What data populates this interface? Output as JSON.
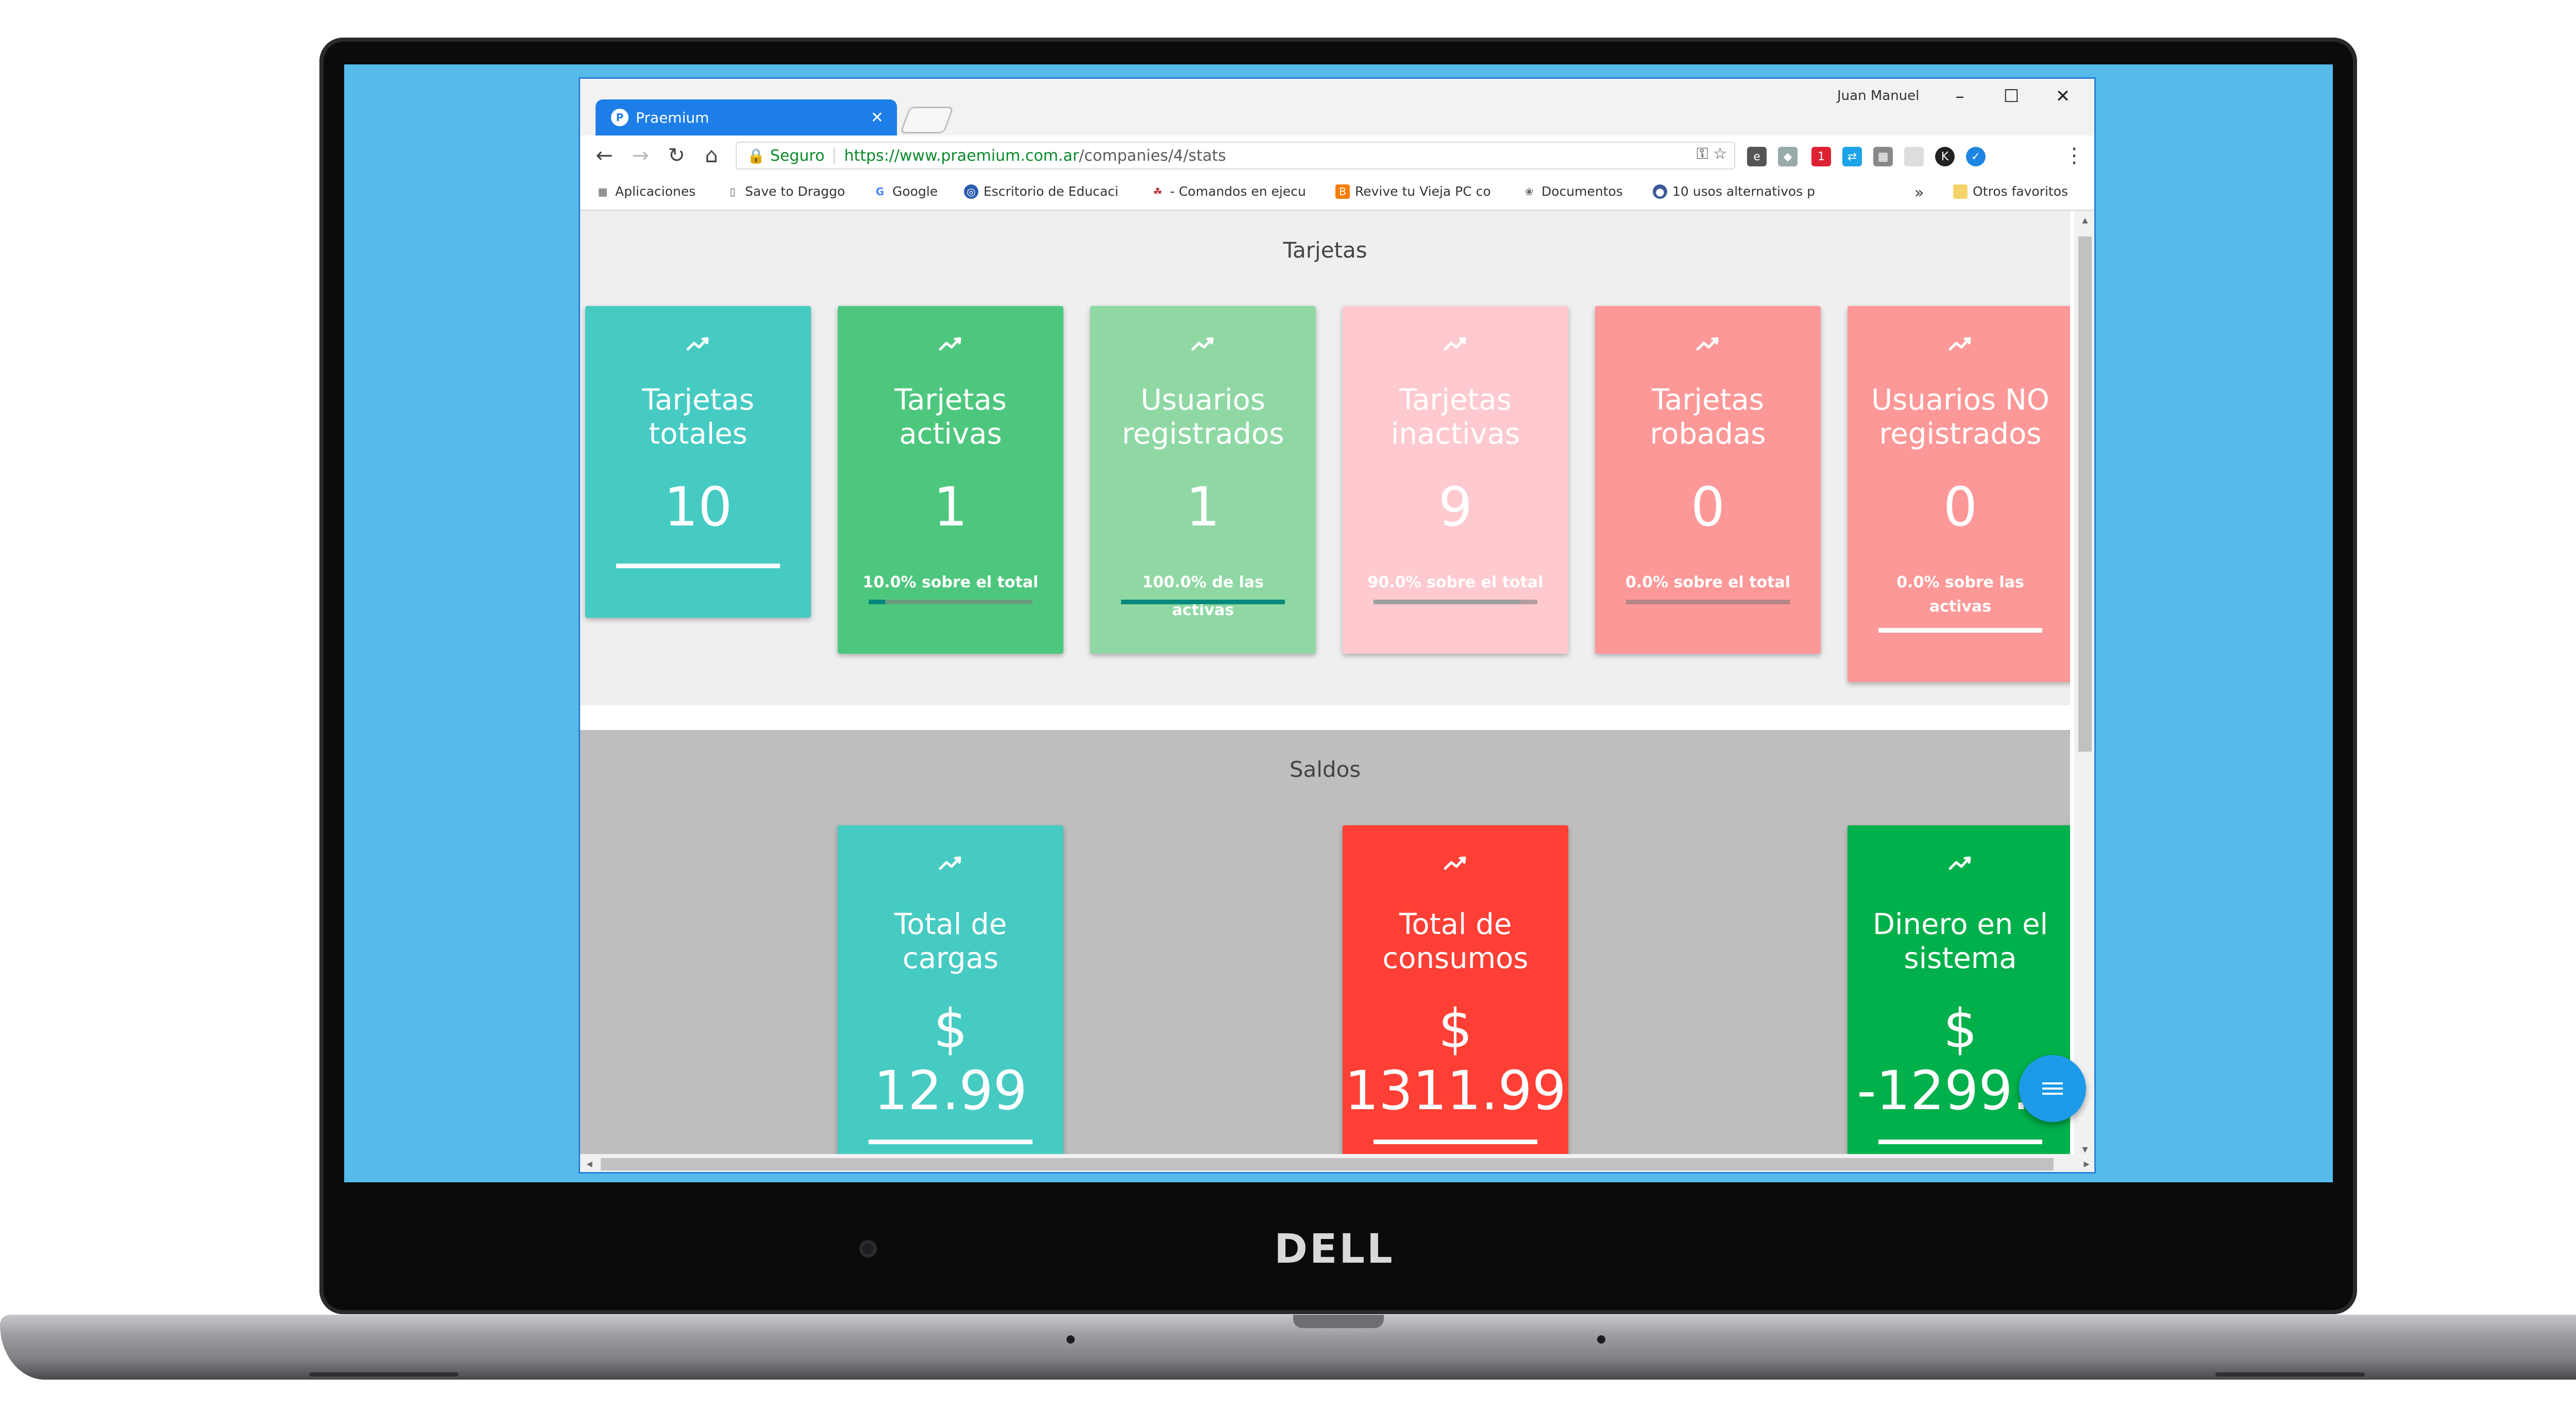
{
  "browser": {
    "tab_title": "Praemium",
    "tab_favicon": "P",
    "user_name": "Juan Manuel",
    "minimize": "–",
    "maximize": "☐",
    "close": "✕",
    "security_label": "Seguro",
    "url_base": "https://www.praemium.com.ar",
    "url_path": "/companies/4/stats"
  },
  "bookmarks": {
    "items": [
      "Aplicaciones",
      "Save to Draggo",
      "Google",
      "Escritorio de Educaci",
      "- Comandos en ejecu",
      "Revive tu Vieja PC co",
      "Documentos",
      "10 usos alternativos p"
    ],
    "overflow": "»",
    "other": "Otros favoritos"
  },
  "tarjetas": {
    "title": "Tarjetas",
    "cards": [
      {
        "label_1": "Tarjetas",
        "label_2": "totales",
        "value": "10",
        "sub": "",
        "color": "#46cbc3",
        "bar": 1.0,
        "bar_color": "#ffffff"
      },
      {
        "label_1": "Tarjetas",
        "label_2": "activas",
        "value": "1",
        "sub": "10.0% sobre el total",
        "color": "#4ec77e",
        "bar": 0.1,
        "bar_color": "#00897b"
      },
      {
        "label_1": "Usuarios",
        "label_2": "registrados",
        "value": "1",
        "sub": "100.0% de las activas",
        "color": "#8fd8a4",
        "bar": 1.0,
        "bar_color": "#00897b"
      },
      {
        "label_1": "Tarjetas",
        "label_2": "inactivas",
        "value": "9",
        "sub": "90.0% sobre el total",
        "color": "#fecacf",
        "bar": 0.9,
        "bar_color": "#9e9e9e"
      },
      {
        "label_1": "Tarjetas",
        "label_2": "robadas",
        "value": "0",
        "sub": "0.0% sobre el total",
        "color": "#fd9898",
        "bar": 0.0,
        "bar_color": "#9e9e9e"
      },
      {
        "label_1": "Usuarios NO",
        "label_2": "registrados",
        "value": "0",
        "sub_1": "0.0% sobre las",
        "sub_2": "activas",
        "color": "#fd9898",
        "bar": 1.0,
        "bar_color": "#ffffff"
      }
    ]
  },
  "saldos": {
    "title": "Saldos",
    "cards": [
      {
        "label_1": "Total de",
        "label_2": "cargas",
        "currency": "$",
        "amount": "12.99",
        "color": "#46cbc3"
      },
      {
        "label_1": "Total de",
        "label_2": "consumos",
        "currency": "$",
        "amount": "1311.99",
        "color": "#fe3f35"
      },
      {
        "label_1": "Dinero en el",
        "label_2": "sistema",
        "currency": "$",
        "amount": "-1299.0",
        "color": "#00b04a"
      }
    ]
  },
  "fab_icon": "menu-icon",
  "laptop_brand": "DELL"
}
